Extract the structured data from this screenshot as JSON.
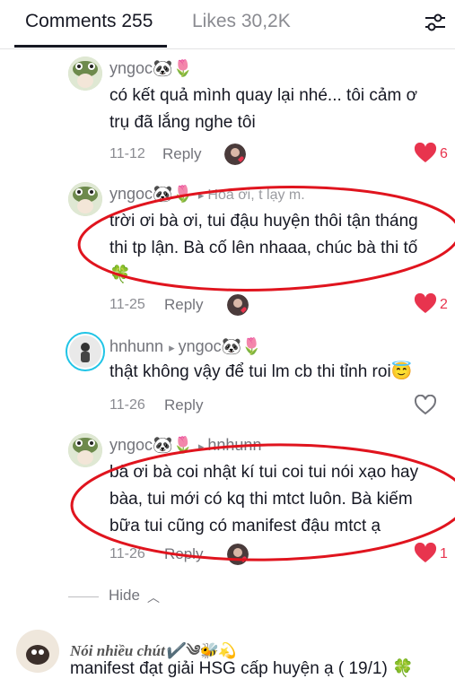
{
  "tabs": {
    "comments": "Comments 255",
    "likes": "Likes 30,2K"
  },
  "comments": [
    {
      "user": "yngoc🐼🌷",
      "lines": [
        "có kết quả mình quay lại nhé... tôi cảm ơ",
        "trụ đã lắng nghe tôi"
      ],
      "date": "11-12",
      "reply": "Reply",
      "likes": "6",
      "liked": true
    },
    {
      "user": "yngoc🐼🌷",
      "mention": "Hoa ơi, t lạy m.",
      "lines": [
        "trời ơi bà ơi, tui đậu huyện thôi tận tháng",
        "thi tp lận. Bà cố lên nhaaa, chúc bà thi tố",
        "🍀"
      ],
      "date": "11-25",
      "reply": "Reply",
      "likes": "2",
      "liked": true
    },
    {
      "user": "hnhunn",
      "reply_to": "yngoc🐼🌷",
      "lines": [
        "thật không vậy để tui lm cb thi tỉnh roi😇"
      ],
      "date": "11-26",
      "reply": "Reply",
      "liked": false
    },
    {
      "user": "yngoc🐼🌷",
      "reply_to": "hnhunn",
      "lines": [
        "bà ơi bà coi nhật kí tui coi tui nói xạo hay",
        "bàa, tui mới có kq thi mtct luôn. Bà kiếm",
        "bữa tui cũng có manifest đậu mtct ạ"
      ],
      "date": "11-26",
      "reply": "Reply",
      "likes": "1",
      "liked": true
    }
  ],
  "hide_label": "Hide",
  "last_comment": {
    "user": "Nói nhiều chút✔️༄🐝💫",
    "text": "manifest đạt giải HSG cấp huyện ạ ( 19/1) 🍀"
  },
  "colors": {
    "like_red": "#e8344e",
    "annotation_red": "#e0141e"
  }
}
